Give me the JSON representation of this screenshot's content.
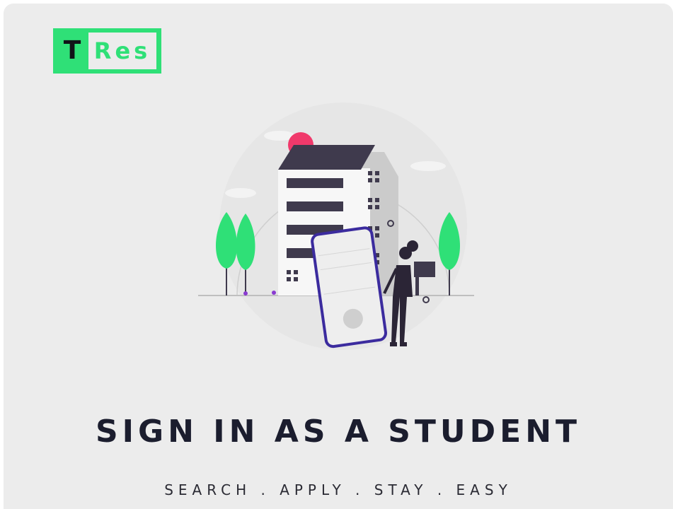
{
  "logo": {
    "letter": "T",
    "word": "Res"
  },
  "main": {
    "headline": "SIGN IN AS A STUDENT",
    "tagline": "SEARCH . APPLY . STAY . EASY"
  },
  "icons": {
    "illustration": "student-residence-illustration"
  },
  "colors": {
    "brand_green": "#2fe077",
    "background": "#ececec",
    "headline": "#1b1d2e",
    "accent_pink": "#f0396b",
    "phone_outline": "#3b2b9e",
    "building_roof": "#3f3a4d"
  }
}
